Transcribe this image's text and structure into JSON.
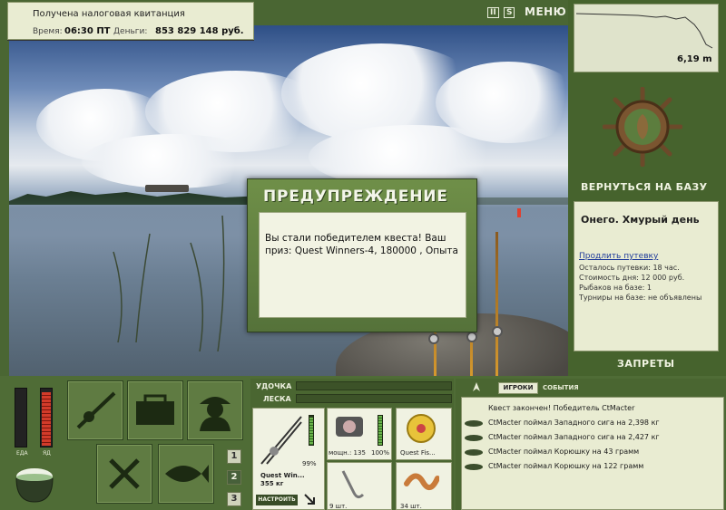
{
  "notification": {
    "message": "Получена налоговая квитанция",
    "time_label": "Время:",
    "time_value": "06:30 ПТ",
    "money_label": "Деньги:",
    "money_value": "853 829 148 руб."
  },
  "top_controls": {
    "pause": "II",
    "sound": "S",
    "menu": "МЕНЮ"
  },
  "depth": {
    "value": "6,19 m"
  },
  "sidebar": {
    "return_button": "ВЕРНУТЬСЯ НА БАЗУ",
    "location_title": "Онего. Хмурый день",
    "extend_link": "Продлить путевку",
    "info_lines": [
      "Осталось путевки: 18 час.",
      "Стоимость дня: 12 000 руб.",
      "Рыбаков на базе: 1",
      "Турниры на базе: не объявлены"
    ],
    "bans_button": "ЗАПРЕТЫ"
  },
  "dialog": {
    "title": "ПРЕДУПРЕЖДЕНИЕ",
    "text": "Вы стали победителем квеста! Ваш приз: Quest Winners-4, 180000 , Опыта"
  },
  "meters": {
    "food_label": "ЕДА",
    "poison_label": "ЯД",
    "food_level": 0.0,
    "poison_level": 0.95
  },
  "slot_buttons": [
    "1",
    "2",
    "3"
  ],
  "tackle": {
    "rod_label": "УДОЧКА",
    "line_label": "ЛЕСКА",
    "rod_name": "Quest Win...",
    "rod_weight": "355 кг",
    "rod_percent": "99%",
    "reel_power": "мощн.: 135",
    "reel_percent": "100%",
    "line_name": "Quest Fis...",
    "hooks_count": "9 шт.",
    "bait_count": "34 шт.",
    "setup_button": "НАСТРОИТЬ"
  },
  "events": {
    "tab_players": "ИГРОКИ",
    "tab_events": "СОБЫТИЯ",
    "items": [
      "Квест закончен! Победитель CtMacter",
      "CtMacter поймал Западного сига на 2,398 кг",
      "CtMacter поймал Западного сига на 2,427 кг",
      "CtMacter поймал Корюшку на 43 грамм",
      "CtMacter поймал Корюшку на 122 грамм"
    ]
  },
  "colors": {
    "panel_green": "#4a6633",
    "panel_light": "#e9ecd2",
    "accent_red": "#d23b2a",
    "link_blue": "#1f3b9a"
  }
}
